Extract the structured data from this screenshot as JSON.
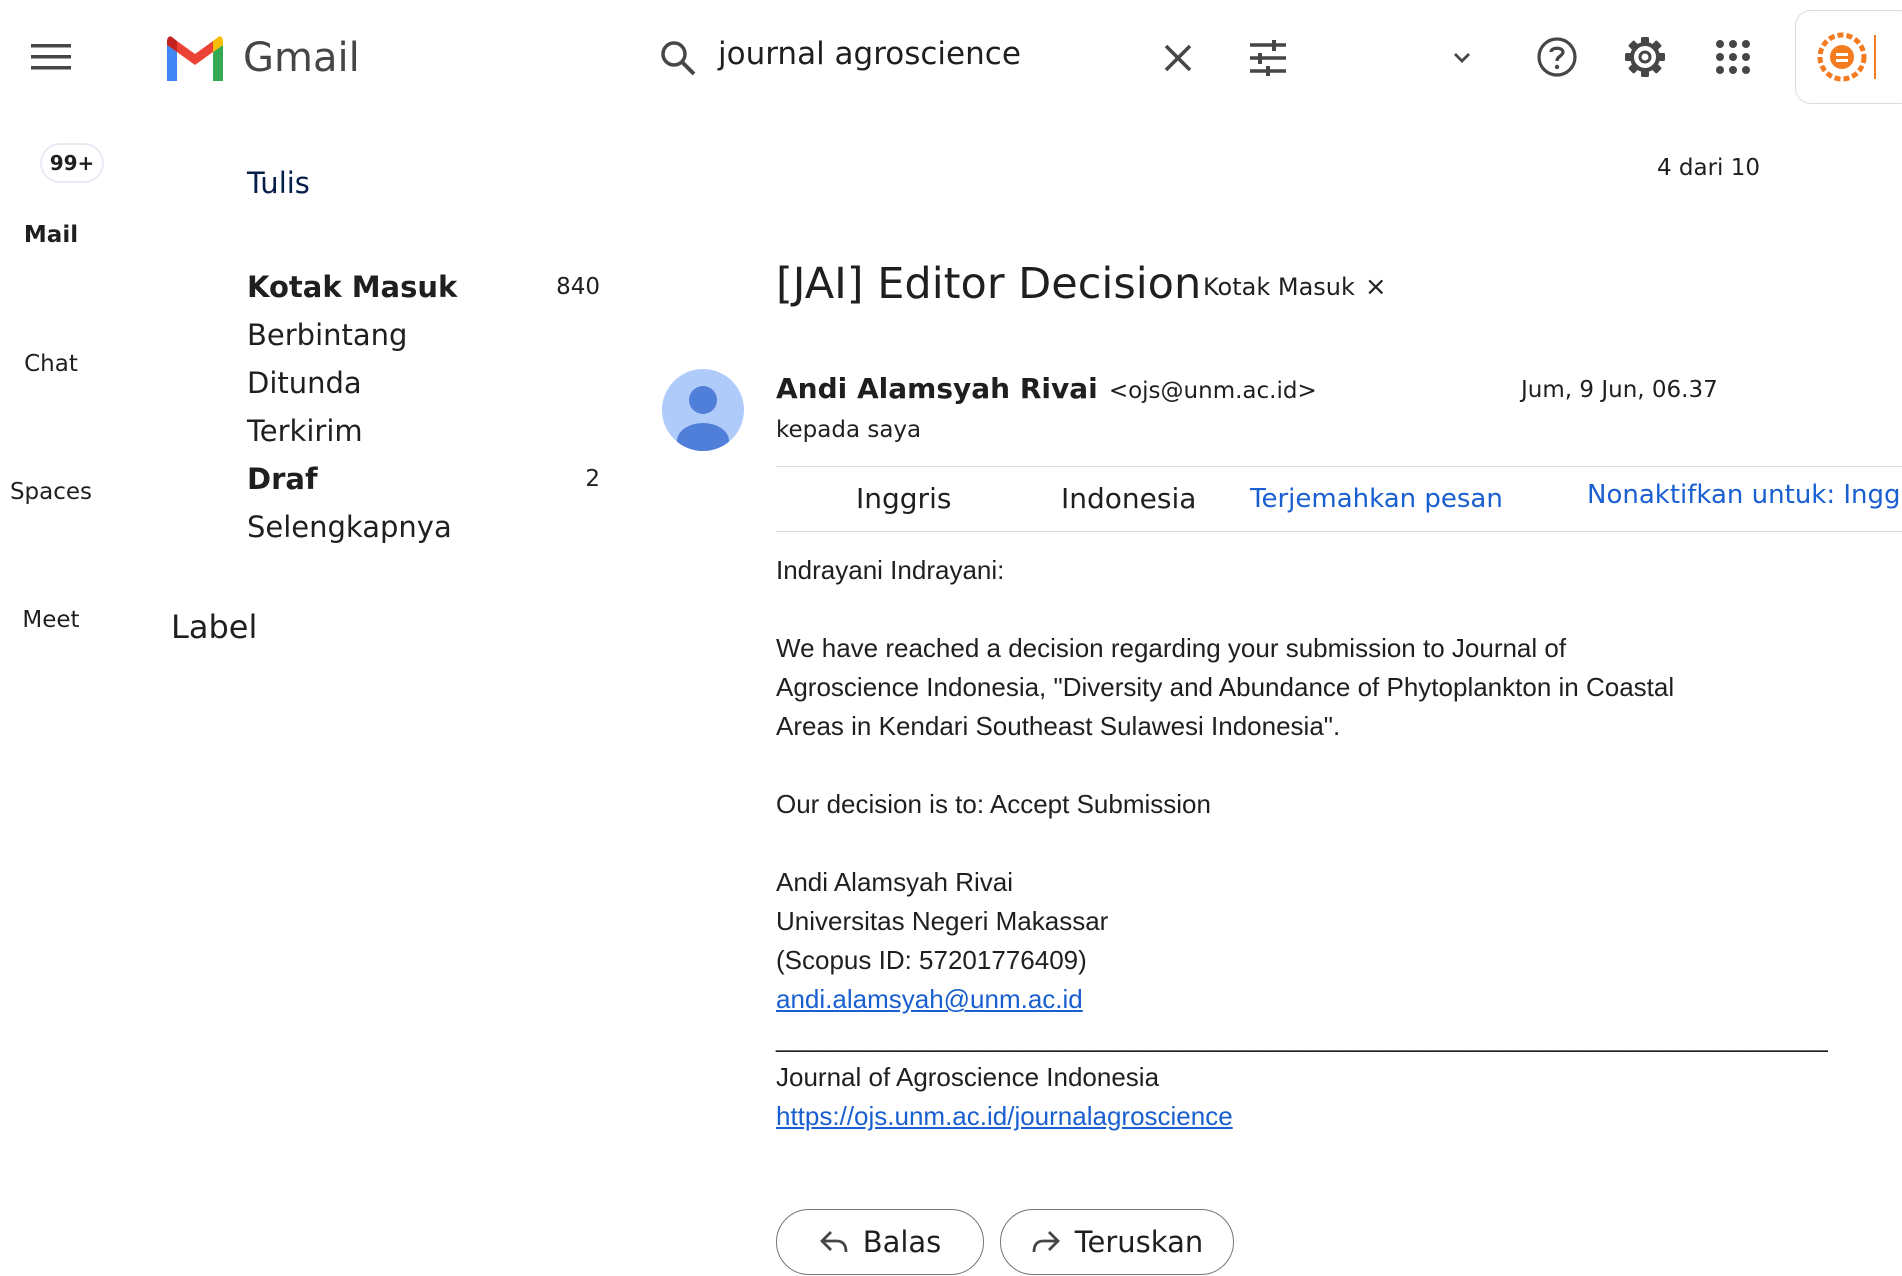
{
  "app": {
    "name": "Gmail"
  },
  "search": {
    "query": "journal agroscience"
  },
  "rail": {
    "badge": "99+",
    "items": [
      {
        "label": "Mail"
      },
      {
        "label": "Chat"
      },
      {
        "label": "Spaces"
      },
      {
        "label": "Meet"
      }
    ]
  },
  "sidebar": {
    "compose": "Tulis",
    "folders": [
      {
        "label": "Kotak Masuk",
        "count": "840"
      },
      {
        "label": "Berbintang",
        "count": ""
      },
      {
        "label": "Ditunda",
        "count": ""
      },
      {
        "label": "Terkirim",
        "count": ""
      },
      {
        "label": "Draf",
        "count": "2"
      },
      {
        "label": "Selengkapnya",
        "count": ""
      }
    ],
    "labels_heading": "Label"
  },
  "pager": {
    "text": "4 dari 10"
  },
  "email": {
    "subject": "[JAI] Editor Decision",
    "tag": "Kotak Masuk",
    "tag_close": "×",
    "sender_name": "Andi Alamsyah Rivai",
    "sender_email": "<ojs@unm.ac.id>",
    "date": "Jum, 9 Jun, 06.37",
    "to": "kepada saya",
    "translate": {
      "from": "Inggris",
      "to": "Indonesia",
      "action": "Terjemahkan pesan",
      "disable": "Nonaktifkan untuk: Inggris"
    },
    "body": {
      "greeting": "Indrayani Indrayani:",
      "para1": [
        "We have reached a decision regarding your submission to Journal of",
        "Agroscience Indonesia, \"Diversity and Abundance of Phytoplankton in Coastal",
        "Areas in Kendari  Southeast Sulawesi Indonesia\"."
      ],
      "decision": "Our decision is to: Accept Submission",
      "sig_name": "Andi Alamsyah Rivai",
      "sig_org": "Universitas Negeri Makassar",
      "sig_scopus": "(Scopus ID: 57201776409)",
      "sig_email": "andi.alamsyah@unm.ac.id",
      "separator": "________________________________________________________________________",
      "journal_name": "Journal of Agroscience Indonesia",
      "journal_url": "https://ojs.unm.ac.id/journalagroscience"
    },
    "actions": {
      "reply": "Balas",
      "forward": "Teruskan"
    }
  },
  "colors": {
    "link": "#1a5fd0",
    "icon": "#444746",
    "avatar_bg": "#aecbfa",
    "avatar_fg": "#4f7fd8",
    "account_orange": "#f47b20"
  }
}
